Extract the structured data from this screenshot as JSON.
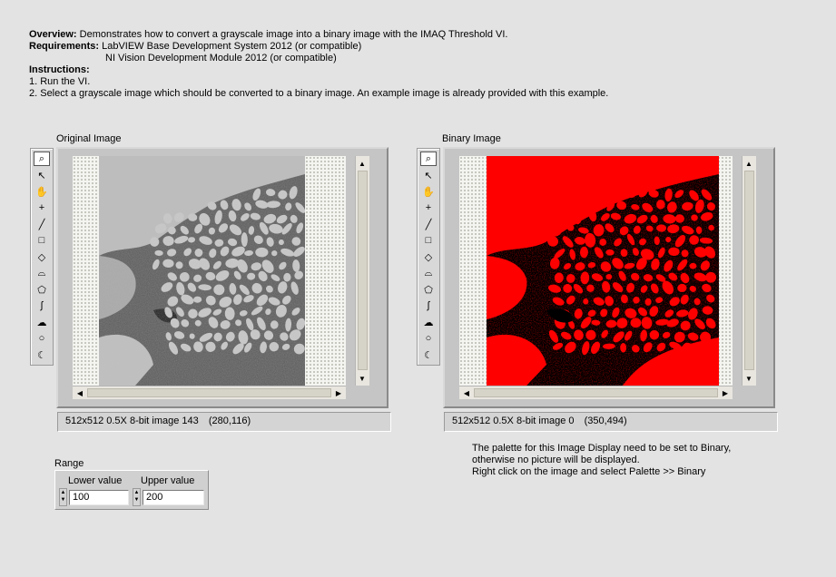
{
  "info": {
    "overview_label": "Overview:",
    "overview_text": "Demonstrates how to convert a grayscale image into a binary image with the IMAQ Threshold VI.",
    "requirements_label": "Requirements:",
    "requirements_1": "LabVIEW Base Development System 2012 (or compatible)",
    "requirements_2": "NI Vision Development Module 2012 (or compatible)",
    "instructions_label": "Instructions:",
    "instruction_1": "1. Run the VI.",
    "instruction_2": "2. Select a grayscale image which should be converted to a binary image. An example image is already provided with this example."
  },
  "original": {
    "caption": "Original Image",
    "status_info": "512x512 0.5X 8-bit image 143",
    "status_coords": "(280,116)"
  },
  "binary": {
    "caption": "Binary Image",
    "status_info": "512x512 0.5X 8-bit image 0",
    "status_coords": "(350,494)"
  },
  "palette_tools": [
    {
      "name": "zoom-tool",
      "glyph": "⌕"
    },
    {
      "name": "pointer-tool",
      "glyph": "↖"
    },
    {
      "name": "pan-tool",
      "glyph": "✋"
    },
    {
      "name": "point-tool",
      "glyph": "+"
    },
    {
      "name": "line-tool",
      "glyph": "╱"
    },
    {
      "name": "rectangle-tool",
      "glyph": "□"
    },
    {
      "name": "rotated-rectangle-tool",
      "glyph": "◇"
    },
    {
      "name": "annulus-tool",
      "glyph": "⌓"
    },
    {
      "name": "polygon-tool",
      "glyph": "⬠"
    },
    {
      "name": "freehand-line-tool",
      "glyph": "∫"
    },
    {
      "name": "freehand-region-tool",
      "glyph": "☁"
    },
    {
      "name": "oval-tool",
      "glyph": "○"
    },
    {
      "name": "broken-line-tool",
      "glyph": "☾"
    }
  ],
  "range": {
    "caption": "Range",
    "lower_label": "Lower value",
    "lower_value": "100",
    "upper_label": "Upper value",
    "upper_value": "200"
  },
  "note": {
    "line1": "The palette for this Image Display need to be set to Binary,",
    "line2": "otherwise no picture will be displayed.",
    "line3": "Right click on the image and select Palette >> Binary"
  },
  "colors": {
    "binary_foreground": "#ff0000",
    "binary_background": "#000000",
    "panel_background": "#e3e3e3"
  }
}
